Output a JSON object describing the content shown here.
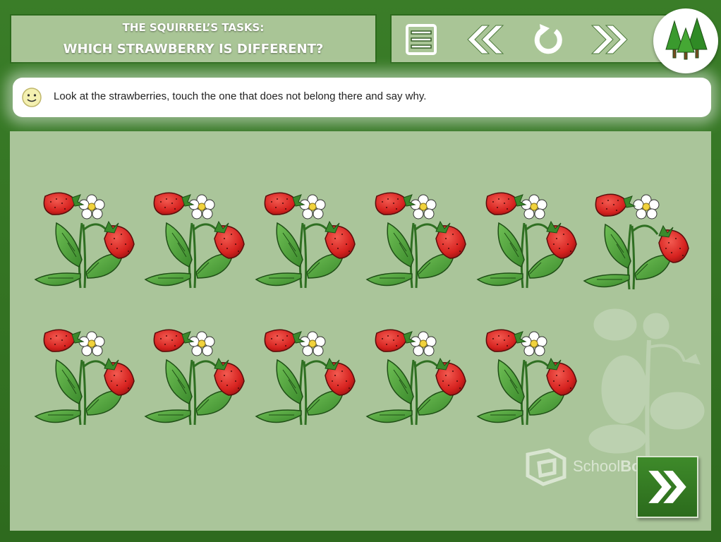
{
  "header": {
    "subtitle": "THE SQUIRREL’S TASKS:",
    "title": "WHICH STRAWBERRY IS DIFFERENT?"
  },
  "nav": {
    "menu_icon": "menu-icon",
    "back_icon": "double-chevron-left-icon",
    "restart_icon": "restart-icon",
    "forward_icon": "double-chevron-right-icon",
    "logo_icon": "forest-trees-icon"
  },
  "instruction": {
    "icon": "smiley-icon",
    "text": "Look at the strawberries, touch the one that does not belong there and say why."
  },
  "plants": {
    "row1_count": 6,
    "row2_count": 5,
    "different_index": 5
  },
  "branding": {
    "school": "School",
    "board": "Board"
  },
  "colors": {
    "frame_green": "#2f6b1f",
    "panel_green": "#a9c596",
    "play_area": "#aac59a",
    "strawberry_red": "#d9262a",
    "leaf_green": "#4c9a3a"
  }
}
